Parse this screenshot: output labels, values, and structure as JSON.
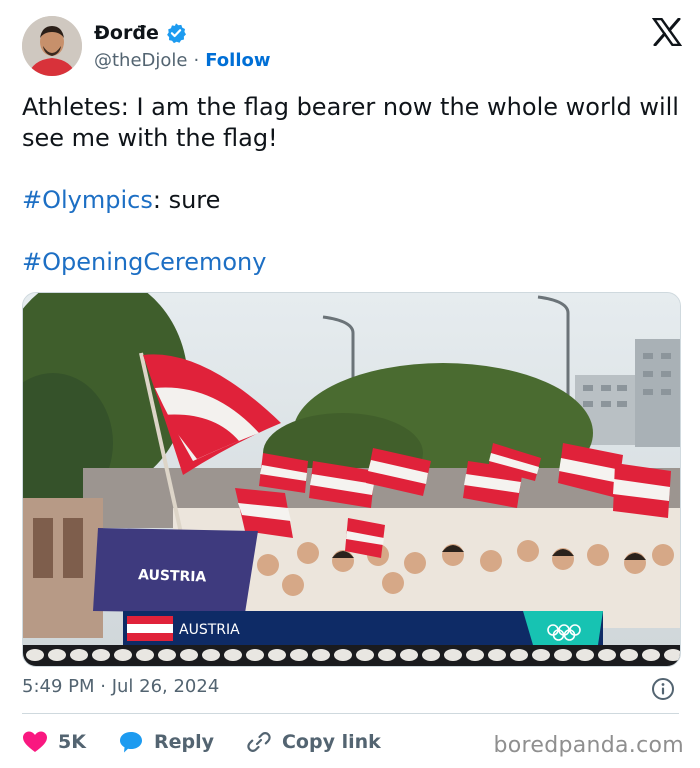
{
  "author": {
    "display_name": "Đorđe",
    "handle": "@theDjole",
    "separator": "·",
    "follow_label": "Follow"
  },
  "tweet": {
    "line1": "Athletes: I am the flag bearer now the whole world will see me with the flag!",
    "hashtag1": "#Olympics",
    "hashtag1_suffix": ": sure",
    "hashtag2": "#OpeningCeremony"
  },
  "media": {
    "banner_sign_text": "AUSTRIA",
    "lower_third_country": "AUSTRIA"
  },
  "timestamp": "5:49 PM · Jul 26, 2024",
  "actions": {
    "like_count": "5K",
    "reply_label": "Reply",
    "copy_link_label": "Copy link"
  },
  "watermark": "boredpanda.com",
  "colors": {
    "link_blue": "#1d6fc4",
    "like_pink": "#f91880",
    "reply_blue": "#1d9bf0",
    "austria_red": "#e0223a"
  }
}
